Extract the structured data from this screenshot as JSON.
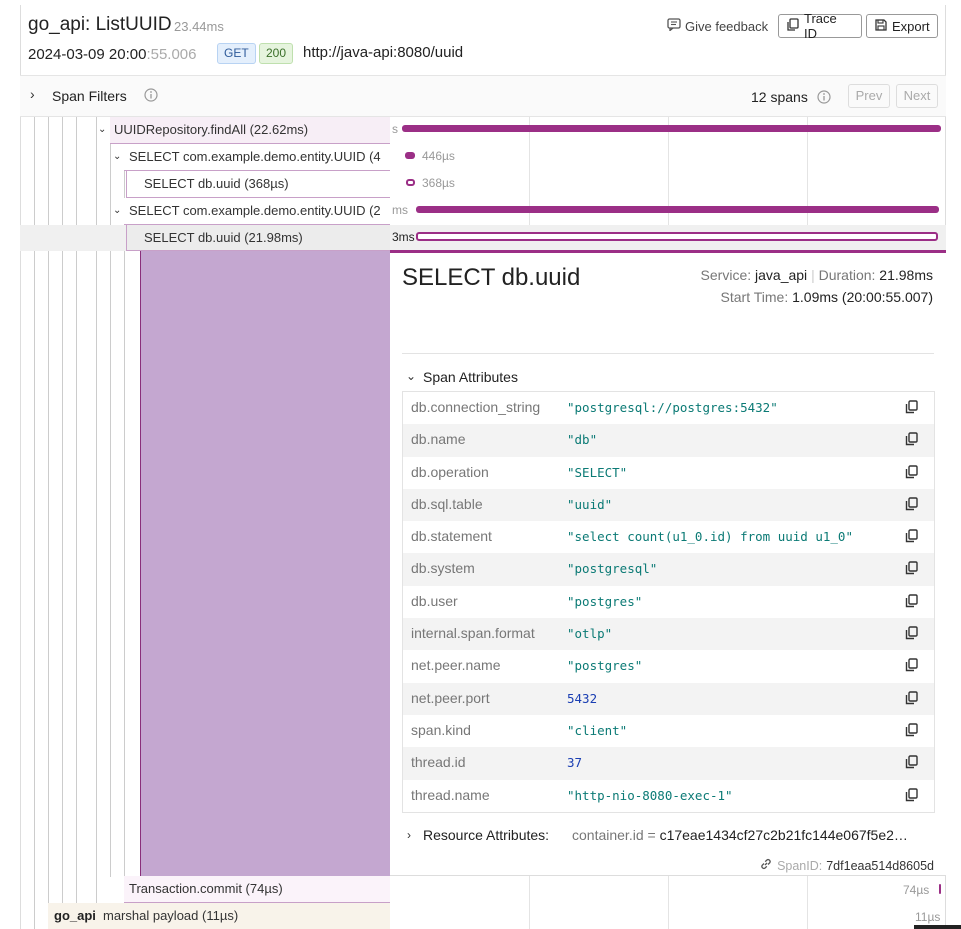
{
  "header": {
    "title": "go_api: ListUUID",
    "duration": "23.44ms",
    "date_main": "2024-03-09 20:00",
    "date_dim": ":55.006",
    "method": "GET",
    "status": "200",
    "url": "http://java-api:8080/uuid",
    "feedback_label": "Give feedback",
    "trace_id_label": "Trace ID",
    "export_label": "Export"
  },
  "filters": {
    "label": "Span Filters",
    "span_count": "12 spans",
    "prev_label": "Prev",
    "next_label": "Next"
  },
  "rows": [
    {
      "label": "UUIDRepository.findAll (22.62ms)",
      "bar_label": "s"
    },
    {
      "label": "SELECT com.example.demo.entity.UUID (4",
      "bar_label": "446µs"
    },
    {
      "label": "SELECT db.uuid (368µs)",
      "bar_label": "368µs"
    },
    {
      "label": "SELECT com.example.demo.entity.UUID (2",
      "bar_label": "ms"
    },
    {
      "label": "SELECT db.uuid (21.98ms)",
      "bar_label": "3ms"
    },
    {
      "label": "Transaction.commit (74µs)",
      "bar_label": "74µs"
    },
    {
      "service": "go_api",
      "label": "marshal payload (11µs)",
      "bar_label": "11µs"
    }
  ],
  "detail": {
    "title": "SELECT db.uuid",
    "service_label": "Service:",
    "service": "java_api",
    "duration_label": "Duration:",
    "duration": "21.98ms",
    "start_label": "Start Time:",
    "start": "1.09ms (20:00:55.007)",
    "span_attributes_label": "Span Attributes",
    "attributes": [
      {
        "key": "db.connection_string",
        "value": "\"postgresql://postgres:5432\""
      },
      {
        "key": "db.name",
        "value": "\"db\""
      },
      {
        "key": "db.operation",
        "value": "\"SELECT\""
      },
      {
        "key": "db.sql.table",
        "value": "\"uuid\""
      },
      {
        "key": "db.statement",
        "value": "\"select count(u1_0.id) from uuid u1_0\""
      },
      {
        "key": "db.system",
        "value": "\"postgresql\""
      },
      {
        "key": "db.user",
        "value": "\"postgres\""
      },
      {
        "key": "internal.span.format",
        "value": "\"otlp\""
      },
      {
        "key": "net.peer.name",
        "value": "\"postgres\""
      },
      {
        "key": "net.peer.port",
        "value": "5432"
      },
      {
        "key": "span.kind",
        "value": "\"client\""
      },
      {
        "key": "thread.id",
        "value": "37"
      },
      {
        "key": "thread.name",
        "value": "\"http-nio-8080-exec-1\""
      }
    ],
    "resource_attributes_label": "Resource Attributes:",
    "resource_key": "container.id",
    "resource_eq": "=",
    "resource_value": "c17eae1434cf27c2b21fc144e067f5e2…",
    "spanid_label": "SpanID:",
    "spanid": "7df1eaa514d8605d"
  },
  "colors": {
    "span": "#9b2f86",
    "span_light": "#c4a7d0"
  }
}
